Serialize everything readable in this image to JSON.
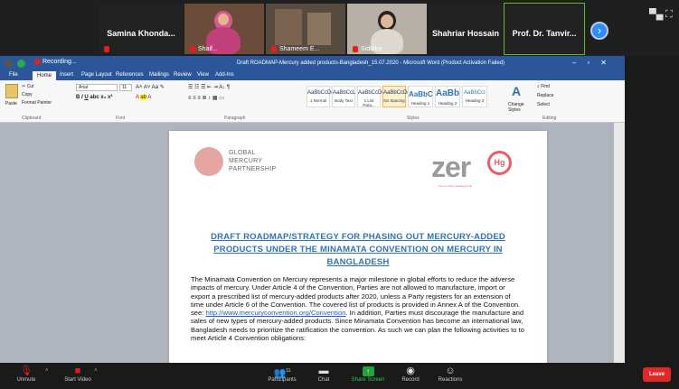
{
  "participants": [
    {
      "name": "Samina Khonda..."
    },
    {
      "name": "Shaif..."
    },
    {
      "name": "Shameem E..."
    },
    {
      "name": "Siddika"
    },
    {
      "name": "Shahriar Hossain"
    },
    {
      "name": "Prof. Dr. Tanvir..."
    }
  ],
  "next_page_icon": "chevron-right",
  "recording_label": "Recording...",
  "word": {
    "window_title": "Draft ROADMAP-Mercury added products-Bangladesh_15.07.2020 - Microsoft Word (Product Activation Failed)",
    "menu": [
      "File",
      "Home",
      "Insert",
      "Page Layout",
      "References",
      "Mailings",
      "Review",
      "View",
      "Add-Ins"
    ],
    "clipboard": {
      "paste": "Paste",
      "cut": "Cut",
      "copy": "Copy",
      "format_painter": "Format Painter",
      "label": "Clipboard"
    },
    "font": {
      "name": "Arial",
      "size": "11",
      "label": "Font"
    },
    "paragraph": {
      "label": "Paragraph"
    },
    "styles": {
      "label": "Styles",
      "items": [
        {
          "sample": "AaBbCcDc",
          "name": "1 Normal"
        },
        {
          "sample": "AaBbCcL",
          "name": "Body Text"
        },
        {
          "sample": "AaBbCcDc",
          "name": "1 List Para..."
        },
        {
          "sample": "AaBbCcDdI",
          "name": "No Spacing"
        },
        {
          "sample": "AaBbC",
          "name": "Heading 1"
        },
        {
          "sample": "AaBb",
          "name": "Heading 2"
        },
        {
          "sample": "AaBbCcI",
          "name": "Heading 3"
        }
      ],
      "change_styles": "Change Styles"
    },
    "editing": {
      "find": "Find",
      "replace": "Replace",
      "select": "Select",
      "label": "Editing"
    }
  },
  "document": {
    "logo_left": [
      "GLOBAL",
      "MERCURY",
      "PARTNERSHIP"
    ],
    "logo_right": "zer",
    "logo_right_o": "Hg",
    "logo_right_sub": "zero mercury working group",
    "title": "DRAFT ROADMAP/STRATEGY FOR PHASING OUT MERCURY-ADDED PRODUCTS UNDER THE MINAMATA CONVENTION ON MERCURY IN BANGLADESH",
    "para_part1": "The Minamata Convention on Mercury represents a major milestone in global efforts to reduce the adverse impacts of mercury. Under Article 4 of the Convention, Parties are not allowed to manufacture, import or export a prescribed list of mercury-added products after 2020, unless a Party registers for an extension of time under Article 6 of the Convention. The covered list of products is provided in Annex A of the Convention. see:",
    "link": "http://www.mercuryconvention.org/Convention",
    "para_part2": ". In addition, Parties must discourage the manufacture and sales of new types of mercury-added products. Since Minamata Convention has become an international law, Bangladesh needs to prioritize the ratification the convention. As such we can plan the following activities to to meet Article 4 Convention obligations:"
  },
  "toolbar": {
    "unmute": "Unmute",
    "start_video": "Start Video",
    "participants": "Participants",
    "participants_count": "11",
    "chat": "Chat",
    "share_screen": "Share Screen",
    "record": "Record",
    "reactions": "Reactions",
    "leave": "Leave"
  }
}
